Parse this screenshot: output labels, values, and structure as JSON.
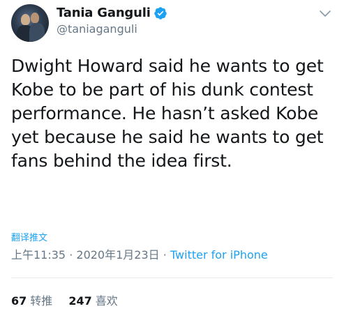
{
  "author": {
    "display_name": "Tania Ganguli",
    "handle": "@taniaganguli"
  },
  "tweet": {
    "text": "Dwight Howard said he wants to get Kobe to be part of his dunk contest performance. He hasn’t asked Kobe yet because he said he wants to get fans behind the idea first.",
    "translate_label": "翻译推文",
    "time": "上午11:35",
    "separator1": " · ",
    "date": "2020年1月23日",
    "separator2": " · ",
    "source": "Twitter for iPhone"
  },
  "stats": {
    "retweets_count": "67",
    "retweets_label": "转推",
    "likes_count": "247",
    "likes_label": "喜欢"
  },
  "icons": {
    "verified": "verified-badge-icon",
    "menu": "chevron-down-icon"
  },
  "colors": {
    "accent": "#1da1f2",
    "secondary_text": "#657786",
    "primary_text": "#14171a"
  }
}
